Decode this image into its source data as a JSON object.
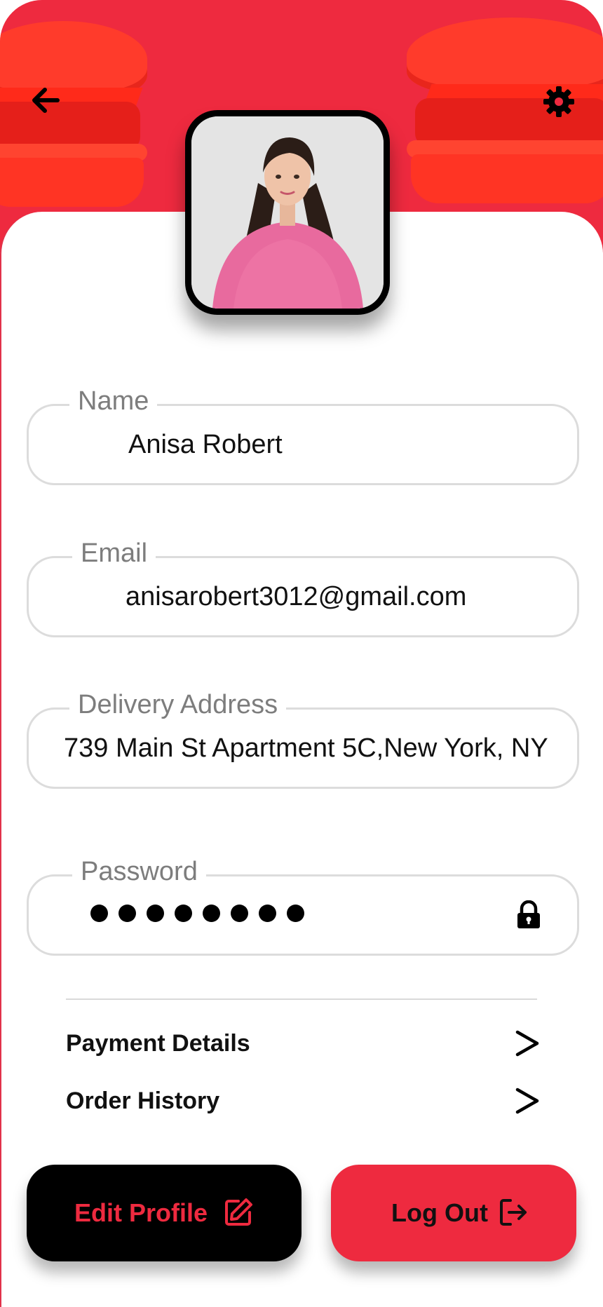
{
  "colors": {
    "accent": "#ee2a3f",
    "text": "#111111",
    "label": "#7d7d7d",
    "border": "#dcdcdc"
  },
  "header": {
    "back_icon": "arrow-left-icon",
    "settings_icon": "gear-icon"
  },
  "profile": {
    "avatar_alt": "profile-photo"
  },
  "fields": {
    "name": {
      "label": "Name",
      "value": "Anisa Robert"
    },
    "email": {
      "label": "Email",
      "value": "anisarobert3012@gmail.com"
    },
    "address": {
      "label": "Delivery Address",
      "value": "739 Main St Apartment 5C,New York, NY"
    },
    "password": {
      "label": "Password",
      "masked_length": 8,
      "icon": "lock-icon"
    }
  },
  "menu": {
    "payment": {
      "label": "Payment Details",
      "icon": "chevron-right-icon"
    },
    "orders": {
      "label": "Order History",
      "icon": "chevron-right-icon"
    }
  },
  "buttons": {
    "edit": {
      "label": "Edit Profile",
      "icon": "edit-icon"
    },
    "logout": {
      "label": "Log Out",
      "icon": "logout-icon"
    }
  }
}
